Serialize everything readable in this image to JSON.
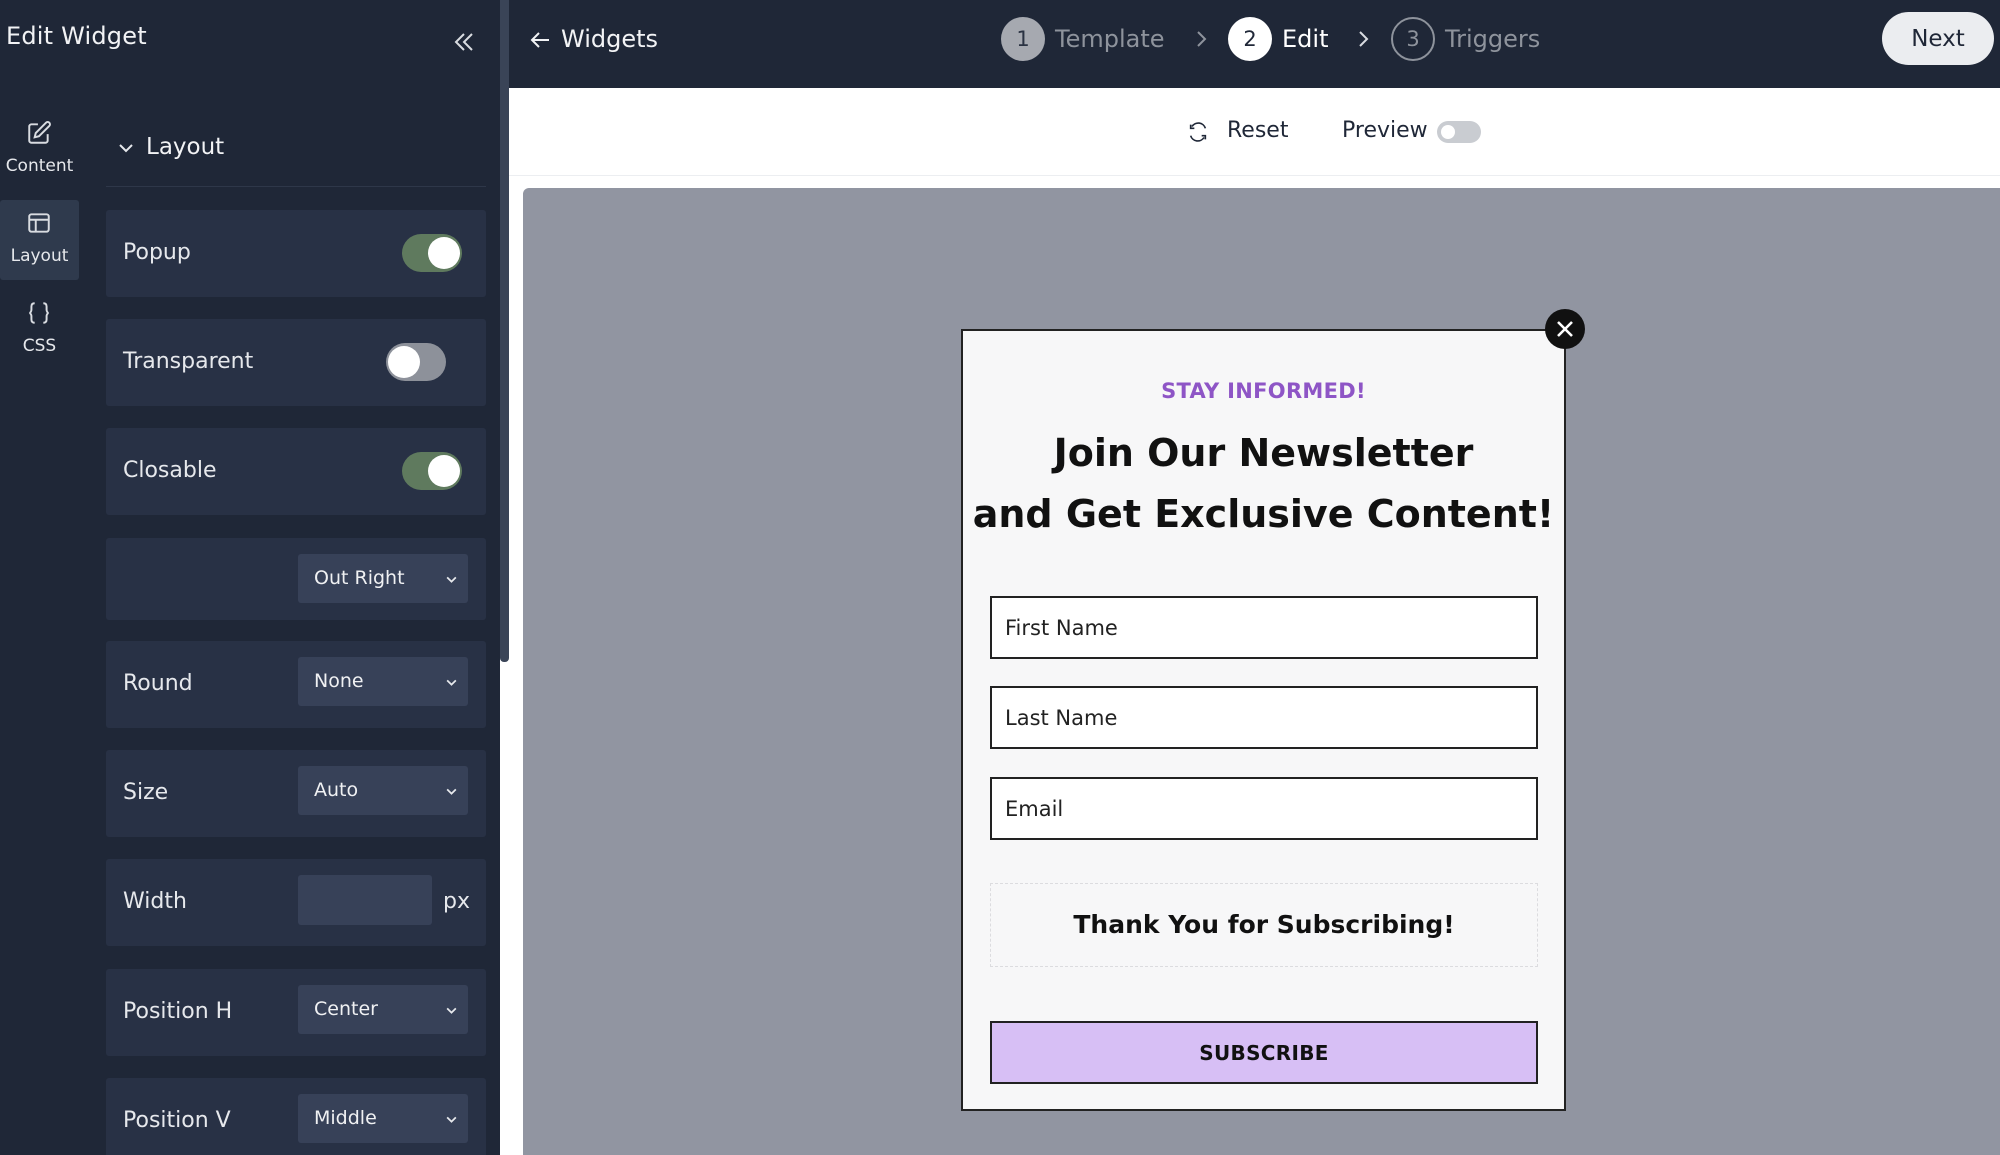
{
  "sidebar": {
    "title": "Edit Widget",
    "rail": [
      {
        "label": "Content",
        "icon": "edit-icon"
      },
      {
        "label": "Layout",
        "icon": "layout-icon",
        "active": true
      },
      {
        "label": "CSS",
        "icon": "braces-icon"
      }
    ],
    "section": "Layout",
    "rows": {
      "popup": {
        "label": "Popup",
        "on": true
      },
      "transparent": {
        "label": "Transparent",
        "on": false
      },
      "closable": {
        "label": "Closable",
        "on": true
      },
      "close_position": {
        "value": "Out Right"
      },
      "round": {
        "label": "Round",
        "value": "None"
      },
      "size": {
        "label": "Size",
        "value": "Auto"
      },
      "width": {
        "label": "Width",
        "value": "",
        "unit": "px"
      },
      "position_h": {
        "label": "Position H",
        "value": "Center"
      },
      "position_v": {
        "label": "Position V",
        "value": "Middle"
      }
    }
  },
  "topbar": {
    "back_label": "Widgets",
    "steps": [
      {
        "number": "1",
        "label": "Template",
        "state": "done"
      },
      {
        "number": "2",
        "label": "Edit",
        "state": "current"
      },
      {
        "number": "3",
        "label": "Triggers",
        "state": "todo"
      }
    ],
    "next_label": "Next"
  },
  "toolbar": {
    "reset_label": "Reset",
    "preview_label": "Preview",
    "preview_on": false
  },
  "popup": {
    "eyebrow": "STAY INFORMED!",
    "heading_line1": "Join Our Newsletter",
    "heading_line2": "and Get Exclusive Content!",
    "fields": {
      "first_name": "First Name",
      "last_name": "Last Name",
      "email": "Email"
    },
    "success_message": "Thank You for Subscribing!",
    "button_label": "SUBSCRIBE"
  },
  "colors": {
    "sidebar_bg": "#1f2737",
    "row_bg": "#283145",
    "toggle_on": "#5f7a5e",
    "eyebrow": "#8e55c6",
    "subscribe_bg": "#d7bff5",
    "stage_bg": "#9195a1"
  }
}
